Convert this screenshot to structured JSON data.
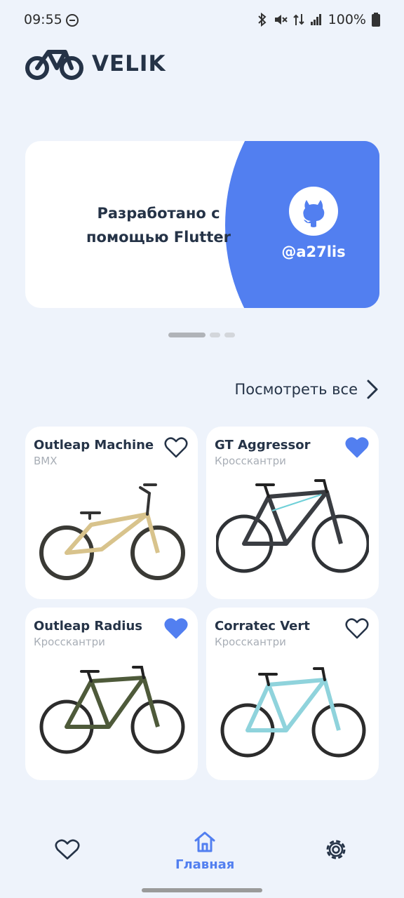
{
  "status_bar": {
    "time": "09:55",
    "battery": "100%",
    "icons": [
      "do-not-disturb-icon",
      "bluetooth-icon",
      "mute-icon",
      "data-arrows-icon",
      "signal-icon",
      "battery-icon"
    ]
  },
  "app": {
    "name": "VELIK",
    "logo_icon": "bicycle-icon"
  },
  "banner": {
    "text": "Разработано с\nпомощью Flutter",
    "handle": "@a27lis",
    "icon": "github-icon",
    "accent_color": "#527ff0",
    "page_count": 3,
    "active_page": 1
  },
  "see_all": {
    "label": "Посмотреть все",
    "icon": "chevron-right-icon"
  },
  "products": [
    {
      "name": "Outleap Machine",
      "category": "BMX",
      "favorite": false,
      "frame_color": "#d8c38c"
    },
    {
      "name": "GT Aggressor",
      "category": "Кросскантри",
      "favorite": true,
      "frame_color": "#3a3d42"
    },
    {
      "name": "Outleap Radius",
      "category": "Кросскантри",
      "favorite": true,
      "frame_color": "#4e5a3a"
    },
    {
      "name": "Corratec Vert",
      "category": "Кросскантри",
      "favorite": false,
      "frame_color": "#8fd3dc"
    }
  ],
  "nav": {
    "favorites_icon": "heart-icon",
    "home_label": "Главная",
    "home_icon": "home-icon",
    "settings_icon": "gear-icon"
  },
  "colors": {
    "background": "#eef3fb",
    "accent": "#527ff0",
    "text": "#253347",
    "muted": "#a8aeb6"
  }
}
